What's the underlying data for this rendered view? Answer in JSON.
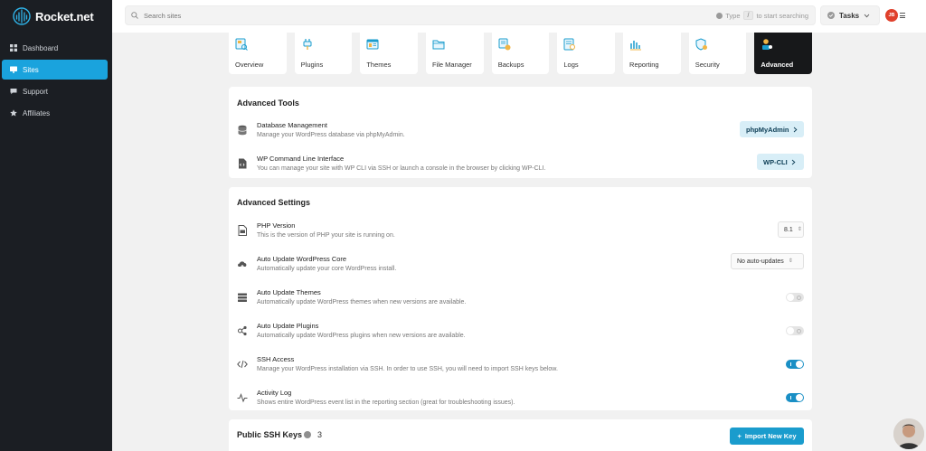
{
  "brand": {
    "name": "Rocket.net"
  },
  "sidebar": {
    "items": [
      {
        "label": "Dashboard",
        "icon": "grid-icon",
        "active": false
      },
      {
        "label": "Sites",
        "icon": "monitor-icon",
        "active": true
      },
      {
        "label": "Support",
        "icon": "chat-icon",
        "active": false
      },
      {
        "label": "Affiliates",
        "icon": "star-icon",
        "active": false
      }
    ]
  },
  "topbar": {
    "search_placeholder": "Search sites",
    "hint_prefix": "Type",
    "hint_key": "/",
    "hint_suffix": "to start searching",
    "tasks_label": "Tasks",
    "user_initials": "JB"
  },
  "tabs": [
    {
      "label": "Overview",
      "icon": "overview-icon",
      "active": false
    },
    {
      "label": "Plugins",
      "icon": "plug-icon",
      "active": false
    },
    {
      "label": "Themes",
      "icon": "themes-icon",
      "active": false
    },
    {
      "label": "File Manager",
      "icon": "folder-icon",
      "active": false
    },
    {
      "label": "Backups",
      "icon": "backup-icon",
      "active": false
    },
    {
      "label": "Logs",
      "icon": "logs-icon",
      "active": false
    },
    {
      "label": "Reporting",
      "icon": "bar-chart-icon",
      "active": false
    },
    {
      "label": "Security",
      "icon": "shield-icon",
      "active": false
    },
    {
      "label": "Advanced",
      "icon": "advanced-icon",
      "active": true
    }
  ],
  "advanced_tools": {
    "title": "Advanced Tools",
    "rows": [
      {
        "title": "Database Management",
        "desc": "Manage your WordPress database via phpMyAdmin.",
        "button": "phpMyAdmin",
        "icon": "database-icon"
      },
      {
        "title": "WP Command Line Interface",
        "desc": "You can manage your site with WP CLI via SSH or launch a console in the browser by clicking WP-CLI.",
        "button": "WP-CLI",
        "icon": "terminal-file-icon"
      }
    ]
  },
  "advanced_settings": {
    "title": "Advanced Settings",
    "php": {
      "title": "PHP Version",
      "desc": "This is the version of PHP your site is running on.",
      "value": "8.1",
      "icon": "php-file-icon"
    },
    "core": {
      "title": "Auto Update WordPress Core",
      "desc": "Automatically update your core WordPress install.",
      "value": "No auto-updates",
      "icon": "cloud-update-icon"
    },
    "themes": {
      "title": "Auto Update Themes",
      "desc": "Automatically update WordPress themes when new versions are available.",
      "enabled": false,
      "icon": "layers-icon"
    },
    "plugins": {
      "title": "Auto Update Plugins",
      "desc": "Automatically update WordPress plugins when new versions are available.",
      "enabled": false,
      "icon": "plugin-update-icon"
    },
    "ssh": {
      "title": "SSH Access",
      "desc": "Manage your WordPress installation via SSH. In order to use SSH, you will need to import SSH keys below.",
      "enabled": true,
      "icon": "code-icon"
    },
    "activity": {
      "title": "Activity Log",
      "desc": "Shows entire WordPress event list in the reporting section (great for troubleshooting issues).",
      "enabled": true,
      "icon": "pulse-icon"
    }
  },
  "ssh_keys": {
    "title": "Public SSH Keys",
    "count": "3",
    "import_label": "Import New Key"
  },
  "colors": {
    "accent": "#1aa3dd",
    "sidebar_bg": "#1b1e23",
    "toggle_on": "#1a8fc5",
    "active_tab": "#17181a"
  }
}
